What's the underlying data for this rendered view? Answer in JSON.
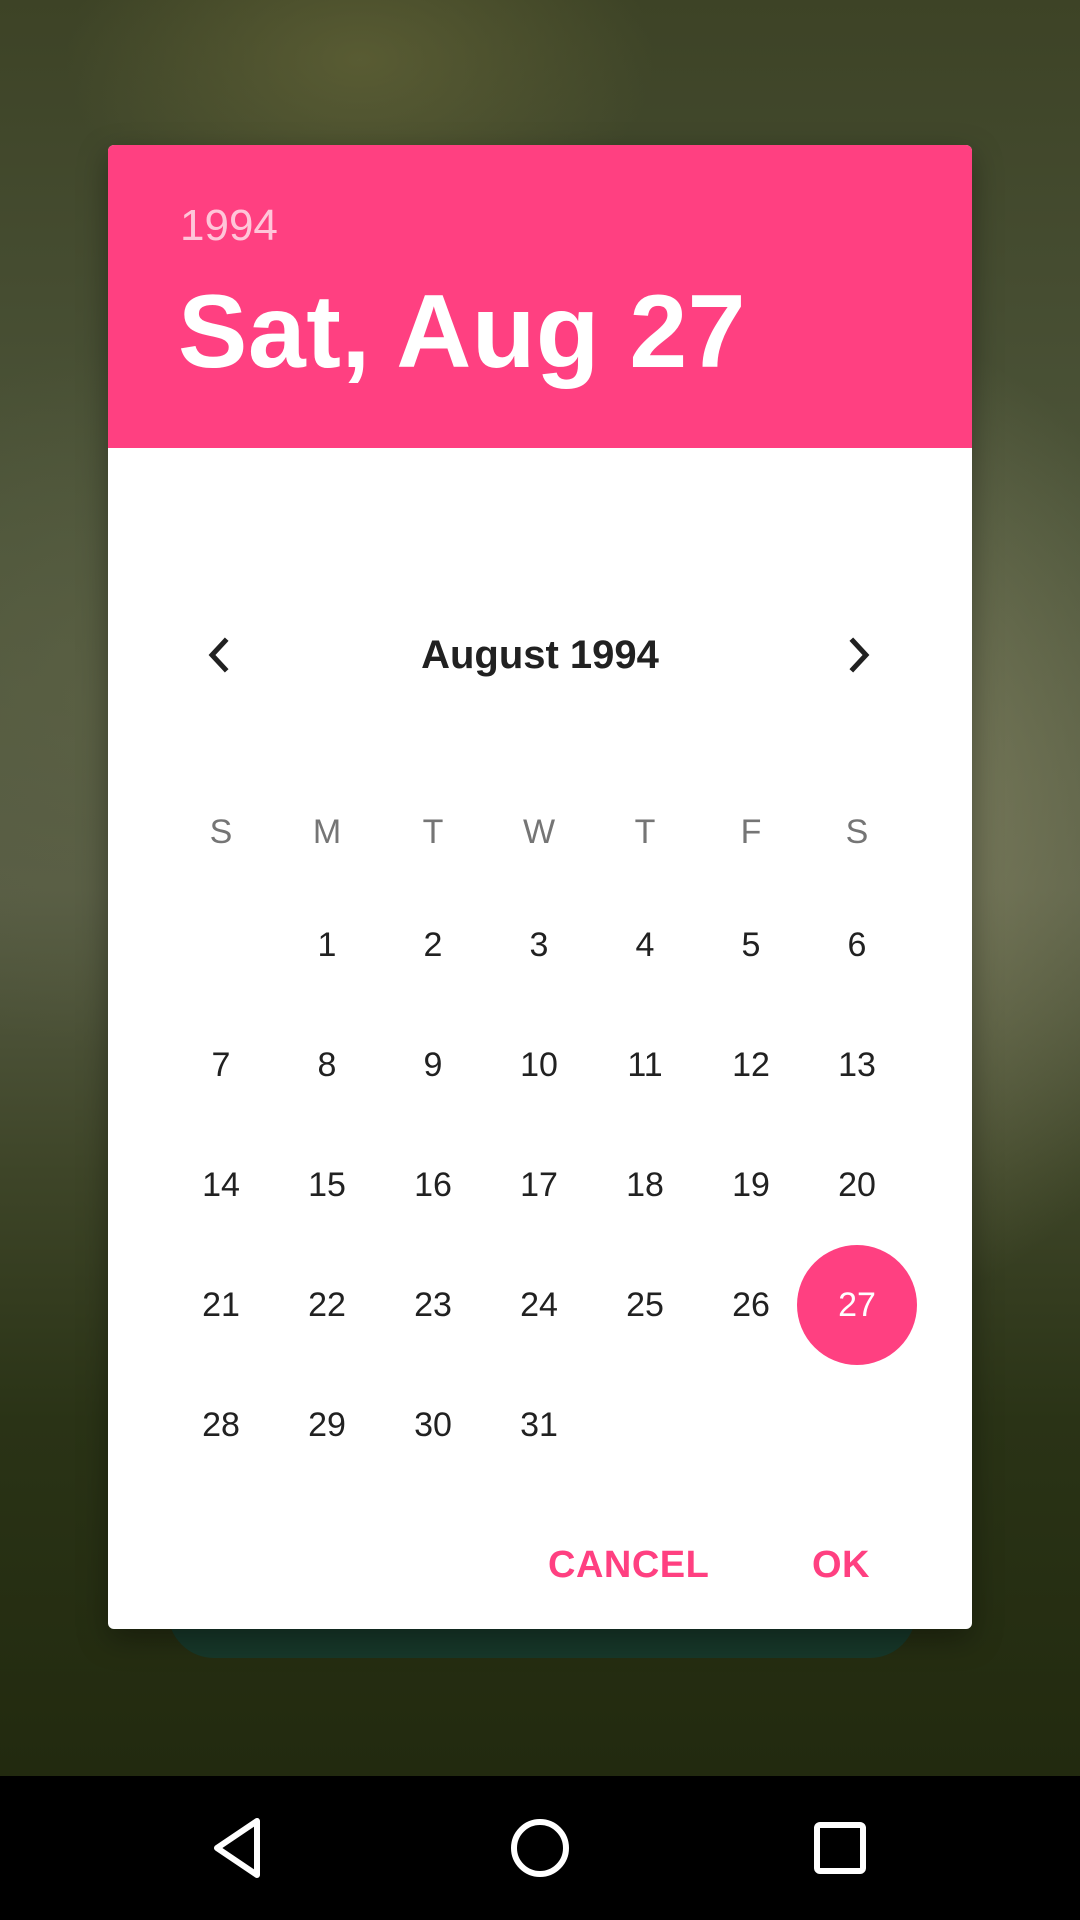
{
  "header": {
    "year": "1994",
    "date": "Sat, Aug 27"
  },
  "calendar": {
    "month_title": "August 1994",
    "weekdays": [
      "S",
      "M",
      "T",
      "W",
      "T",
      "F",
      "S"
    ],
    "first_weekday_index": 1,
    "days_in_month": 31,
    "selected_day": 27,
    "days": [
      "1",
      "2",
      "3",
      "4",
      "5",
      "6",
      "7",
      "8",
      "9",
      "10",
      "11",
      "12",
      "13",
      "14",
      "15",
      "16",
      "17",
      "18",
      "19",
      "20",
      "21",
      "22",
      "23",
      "24",
      "25",
      "26",
      "27",
      "28",
      "29",
      "30",
      "31"
    ]
  },
  "actions": {
    "cancel_label": "CANCEL",
    "ok_label": "OK"
  },
  "icons": {
    "prev": "chevron-left-icon",
    "next": "chevron-right-icon",
    "nav_back": "back-triangle-icon",
    "nav_home": "home-circle-icon",
    "nav_recents": "recents-square-icon"
  },
  "colors": {
    "accent": "#ff4081",
    "header_year": "rgba(255,255,255,0.7)",
    "text_primary": "#212121",
    "text_secondary": "#757575"
  }
}
